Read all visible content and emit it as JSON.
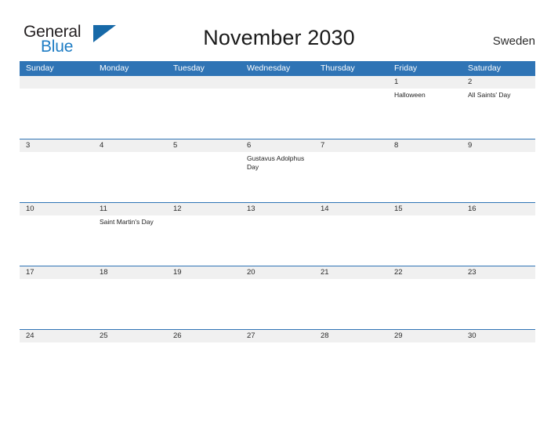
{
  "brand": {
    "logo_text_top": "General",
    "logo_text_bottom": "Blue",
    "logo_icon": "triangle-flag-icon",
    "color_dark": "#231f20",
    "color_blue": "#1d7cc4"
  },
  "header": {
    "title": "November 2030",
    "country": "Sweden",
    "accent_color": "#2f74b5"
  },
  "calendar": {
    "weekdays": [
      "Sunday",
      "Monday",
      "Tuesday",
      "Wednesday",
      "Thursday",
      "Friday",
      "Saturday"
    ],
    "header_bg": "#2f74b5",
    "header_text_color": "#ffffff",
    "daynum_band_bg": "#f0f0f0",
    "weeks": [
      {
        "days": [
          {
            "num": "",
            "event": ""
          },
          {
            "num": "",
            "event": ""
          },
          {
            "num": "",
            "event": ""
          },
          {
            "num": "",
            "event": ""
          },
          {
            "num": "",
            "event": ""
          },
          {
            "num": "1",
            "event": "Halloween"
          },
          {
            "num": "2",
            "event": "All Saints' Day"
          }
        ]
      },
      {
        "days": [
          {
            "num": "3",
            "event": ""
          },
          {
            "num": "4",
            "event": ""
          },
          {
            "num": "5",
            "event": ""
          },
          {
            "num": "6",
            "event": "Gustavus Adolphus Day"
          },
          {
            "num": "7",
            "event": ""
          },
          {
            "num": "8",
            "event": ""
          },
          {
            "num": "9",
            "event": ""
          }
        ]
      },
      {
        "days": [
          {
            "num": "10",
            "event": ""
          },
          {
            "num": "11",
            "event": "Saint Martin's Day"
          },
          {
            "num": "12",
            "event": ""
          },
          {
            "num": "13",
            "event": ""
          },
          {
            "num": "14",
            "event": ""
          },
          {
            "num": "15",
            "event": ""
          },
          {
            "num": "16",
            "event": ""
          }
        ]
      },
      {
        "days": [
          {
            "num": "17",
            "event": ""
          },
          {
            "num": "18",
            "event": ""
          },
          {
            "num": "19",
            "event": ""
          },
          {
            "num": "20",
            "event": ""
          },
          {
            "num": "21",
            "event": ""
          },
          {
            "num": "22",
            "event": ""
          },
          {
            "num": "23",
            "event": ""
          }
        ]
      },
      {
        "days": [
          {
            "num": "24",
            "event": ""
          },
          {
            "num": "25",
            "event": ""
          },
          {
            "num": "26",
            "event": ""
          },
          {
            "num": "27",
            "event": ""
          },
          {
            "num": "28",
            "event": ""
          },
          {
            "num": "29",
            "event": ""
          },
          {
            "num": "30",
            "event": ""
          }
        ]
      }
    ]
  }
}
